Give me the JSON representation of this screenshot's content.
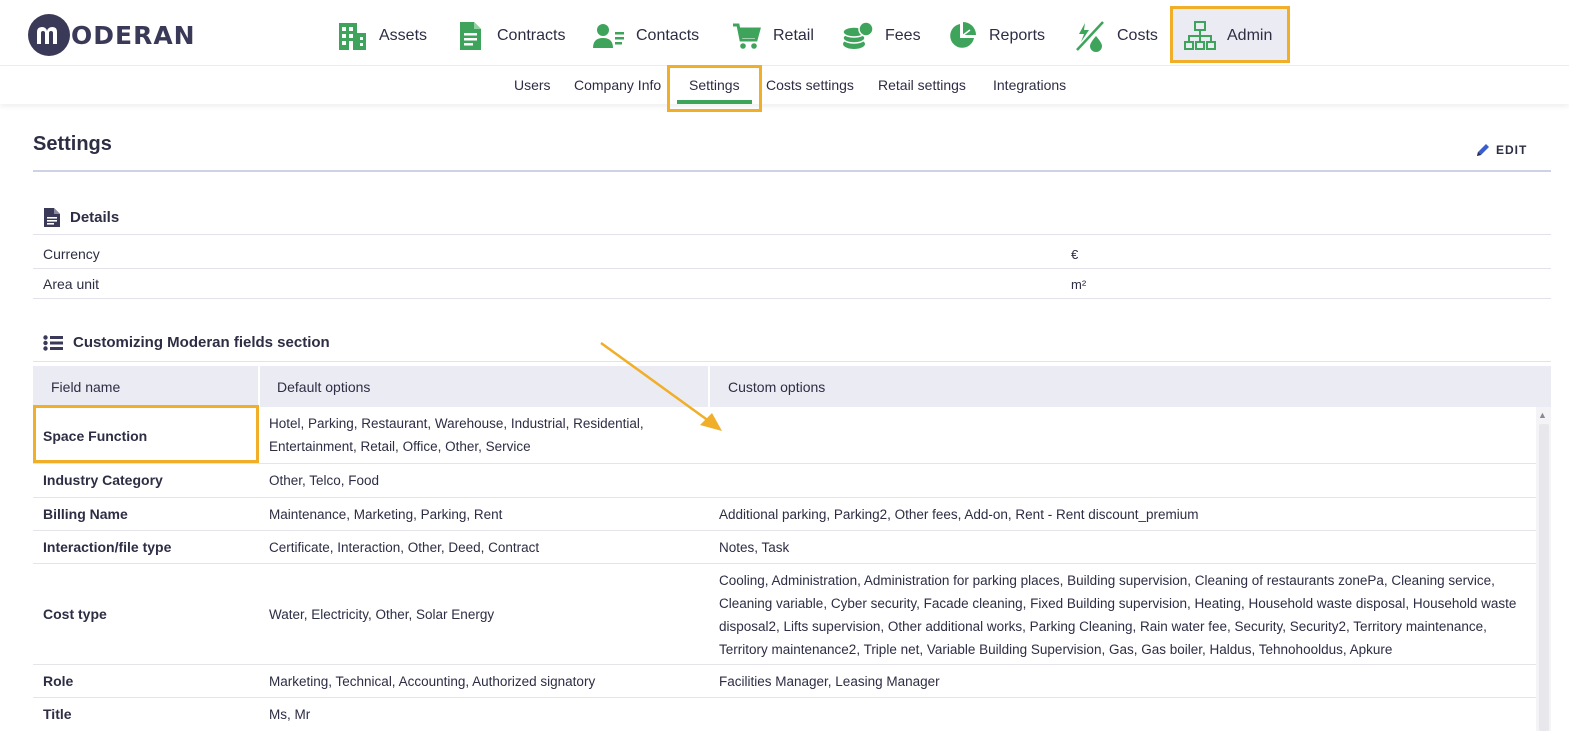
{
  "brand": {
    "logo_text": "ODERAN",
    "logo_letter": "m"
  },
  "nav": {
    "items": [
      {
        "label": "Assets",
        "icon": "building-icon"
      },
      {
        "label": "Contracts",
        "icon": "document-icon"
      },
      {
        "label": "Contacts",
        "icon": "contact-card-icon"
      },
      {
        "label": "Retail",
        "icon": "cart-icon"
      },
      {
        "label": "Fees",
        "icon": "coins-icon"
      },
      {
        "label": "Reports",
        "icon": "pie-chart-icon"
      },
      {
        "label": "Costs",
        "icon": "utility-icon"
      },
      {
        "label": "Admin",
        "icon": "org-chart-icon"
      }
    ],
    "active": "Admin",
    "accent_color": "#3fa45b",
    "highlight_color": "#f1ae29"
  },
  "subnav": {
    "items": [
      "Users",
      "Company Info",
      "Settings",
      "Costs settings",
      "Retail settings",
      "Integrations"
    ],
    "active": "Settings"
  },
  "page": {
    "title": "Settings",
    "edit_label": "EDIT"
  },
  "details": {
    "heading": "Details",
    "rows": [
      {
        "label": "Currency",
        "value": "€"
      },
      {
        "label": "Area unit",
        "value": "m²"
      }
    ]
  },
  "custom_fields": {
    "heading": "Customizing Moderan fields section",
    "columns": [
      "Field name",
      "Default options",
      "Custom options"
    ],
    "rows": [
      {
        "name": "Space Function",
        "default": "Hotel, Parking, Restaurant, Warehouse, Industrial, Residential, Entertainment, Retail, Office, Other, Service",
        "custom": ""
      },
      {
        "name": "Industry Category",
        "default": "Other, Telco, Food",
        "custom": ""
      },
      {
        "name": "Billing Name",
        "default": "Maintenance, Marketing, Parking, Rent",
        "custom": "Additional parking, Parking2, Other fees, Add-on, Rent - Rent discount_premium"
      },
      {
        "name": "Interaction/file type",
        "default": "Certificate, Interaction, Other, Deed, Contract",
        "custom": "Notes, Task"
      },
      {
        "name": "Cost type",
        "default": "Water, Electricity, Other, Solar Energy",
        "custom": "Cooling, Administration, Administration for parking places, Building supervision, Cleaning of restaurants zonePa, Cleaning service, Cleaning variable, Cyber security, Facade cleaning, Fixed Building supervision, Heating, Household waste disposal, Household waste disposal2, Lifts supervision, Other additional works, Parking Cleaning, Rain water fee, Security, Security2, Territory maintenance, Territory maintenance2, Triple net, Variable Building Supervision, Gas, Gas boiler, Haldus, Tehnohooldus, Apkure"
      },
      {
        "name": "Role",
        "default": "Marketing, Technical, Accounting, Authorized signatory",
        "custom": "Facilities Manager, Leasing Manager"
      },
      {
        "name": "Title",
        "default": "Ms, Mr",
        "custom": ""
      }
    ]
  }
}
